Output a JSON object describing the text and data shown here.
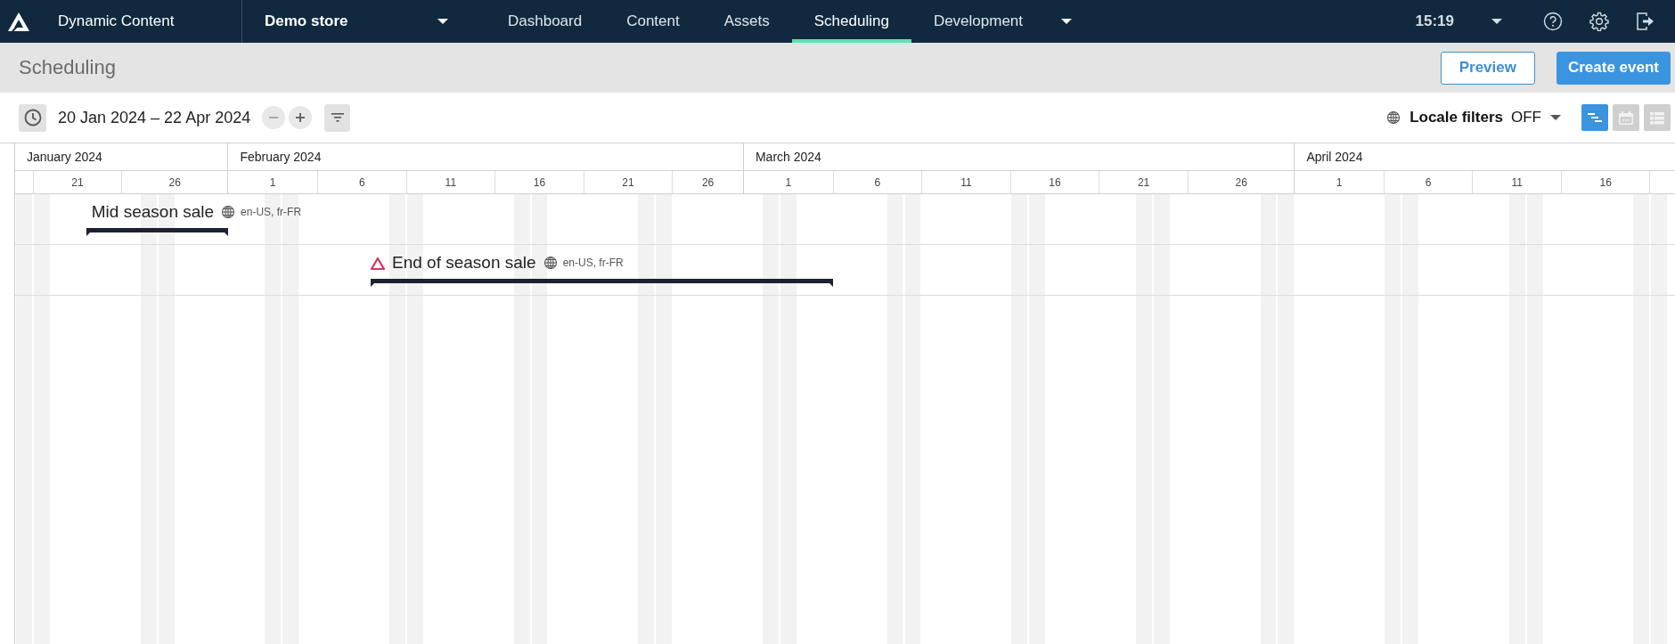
{
  "app": {
    "name": "Dynamic Content"
  },
  "store": {
    "label": "Demo store"
  },
  "nav_tabs": [
    {
      "label": "Dashboard",
      "selected": false
    },
    {
      "label": "Content",
      "selected": false
    },
    {
      "label": "Assets",
      "selected": false
    },
    {
      "label": "Scheduling",
      "selected": true
    },
    {
      "label": "Development",
      "selected": false
    }
  ],
  "clock": "15:19",
  "page": {
    "title": "Scheduling",
    "buttons": [
      {
        "label": "Preview",
        "kind": "secondary"
      },
      {
        "label": "Create event",
        "kind": "primary"
      }
    ]
  },
  "toolbar": {
    "date_range": "20 Jan 2024 – 22 Apr 2024",
    "locale_filters": {
      "label": "Locale filters",
      "value": "OFF"
    },
    "views": [
      {
        "kind": "timeline",
        "selected": true
      },
      {
        "kind": "calendar",
        "selected": false
      },
      {
        "kind": "list",
        "selected": false
      }
    ]
  },
  "timeline": {
    "months": [
      {
        "label": "January 2024",
        "days": [
          "21",
          "26"
        ]
      },
      {
        "label": "February 2024",
        "days": [
          "1",
          "6",
          "11",
          "16",
          "21",
          "26"
        ]
      },
      {
        "label": "March 2024",
        "days": [
          "1",
          "6",
          "11",
          "16",
          "21",
          "26"
        ]
      },
      {
        "label": "April 2024",
        "days": [
          "1",
          "6",
          "11",
          "16"
        ]
      }
    ],
    "events": [
      {
        "name": "Mid season sale",
        "locales": "en-US, fr-FR",
        "warning": false
      },
      {
        "name": "End of season sale",
        "locales": "en-US, fr-FR",
        "warning": true
      }
    ]
  }
}
